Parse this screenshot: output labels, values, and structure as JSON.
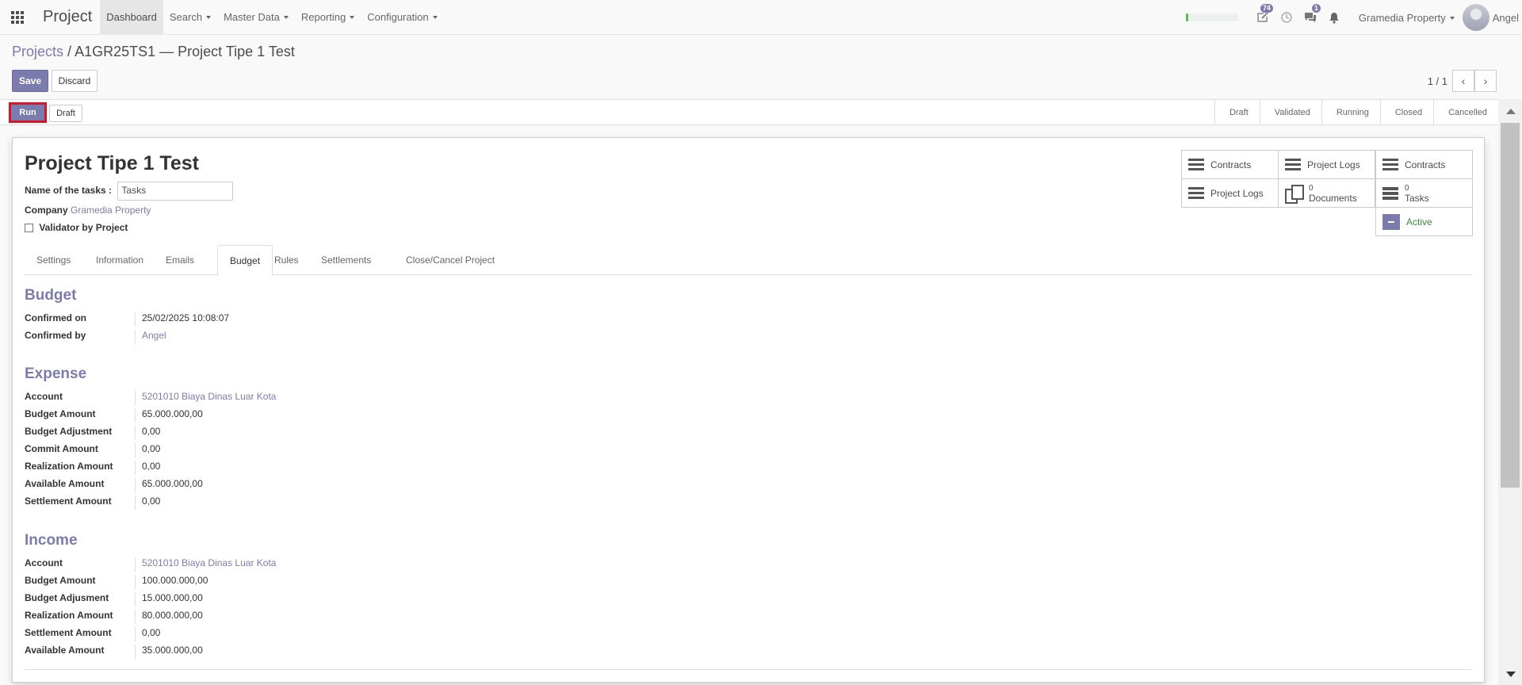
{
  "navbar": {
    "brand": "Project",
    "menu": [
      "Dashboard",
      "Search",
      "Master Data",
      "Reporting",
      "Configuration"
    ],
    "progress_fraction": 0.05,
    "notifications": {
      "activity_count": "74",
      "messages_count": "1"
    },
    "company": "Gramedia Property",
    "user": "Angel"
  },
  "breadcrumb": {
    "parent": "Projects",
    "separator": "/",
    "current": "A1GR25TS1 — Project Tipe 1 Test"
  },
  "controls": {
    "save": "Save",
    "discard": "Discard",
    "pager_value": "1 / 1"
  },
  "statusbar": {
    "run": "Run",
    "draft": "Draft",
    "stages": [
      "Draft",
      "Validated",
      "Running",
      "Closed",
      "Cancelled"
    ]
  },
  "form": {
    "title": "Project Tipe 1 Test",
    "tasks_label": "Name of the tasks :",
    "tasks_value": "Tasks",
    "company_label": "Company",
    "company_value": "Gramedia Property",
    "validator_label": "Validator by Project"
  },
  "smart_buttons": {
    "contracts_1": "Contracts",
    "project_logs_1": "Project Logs",
    "contracts_2": "Contracts",
    "project_logs_2": "Project Logs",
    "documents_count": "0",
    "documents_label": "Documents",
    "tasks_count": "0",
    "tasks_label": "Tasks",
    "active_label": "Active"
  },
  "tabs": [
    "Settings",
    "Information",
    "Emails",
    "Budget",
    "Rules",
    "Settlements",
    "Close/Cancel Project"
  ],
  "budget": {
    "title": "Budget",
    "confirmed_on_label": "Confirmed on",
    "confirmed_on": "25/02/2025 10:08:07",
    "confirmed_by_label": "Confirmed by",
    "confirmed_by": "Angel"
  },
  "expense": {
    "title": "Expense",
    "rows": [
      {
        "label": "Account",
        "value": "5201010 Biaya Dinas Luar Kota"
      },
      {
        "label": "Budget Amount",
        "value": "65.000.000,00"
      },
      {
        "label": "Budget Adjustment",
        "value": "0,00"
      },
      {
        "label": "Commit Amount",
        "value": "0,00"
      },
      {
        "label": "Realization Amount",
        "value": "0,00"
      },
      {
        "label": "Available Amount",
        "value": "65.000.000,00"
      },
      {
        "label": "Settlement Amount",
        "value": "0,00"
      }
    ]
  },
  "income": {
    "title": "Income",
    "rows": [
      {
        "label": "Account",
        "value": "5201010 Biaya Dinas Luar Kota"
      },
      {
        "label": "Budget Amount",
        "value": "100.000.000,00"
      },
      {
        "label": "Budget Adjusment",
        "value": "15.000.000,00"
      },
      {
        "label": "Realization Amount",
        "value": "80.000.000,00"
      },
      {
        "label": "Settlement Amount",
        "value": "0,00"
      },
      {
        "label": "Available Amount",
        "value": "35.000.000,00"
      }
    ]
  },
  "colors": {
    "primary": "#7c7bad",
    "highlight": "#d6162b",
    "active": "#3c8f3c"
  },
  "icons": [
    "apps-grid-icon",
    "edit-icon",
    "clock-icon",
    "chat-icon",
    "bell-icon",
    "chevron-left-icon",
    "chevron-right-icon",
    "list-icon",
    "documents-icon",
    "tasks-icon",
    "archive-icon"
  ]
}
